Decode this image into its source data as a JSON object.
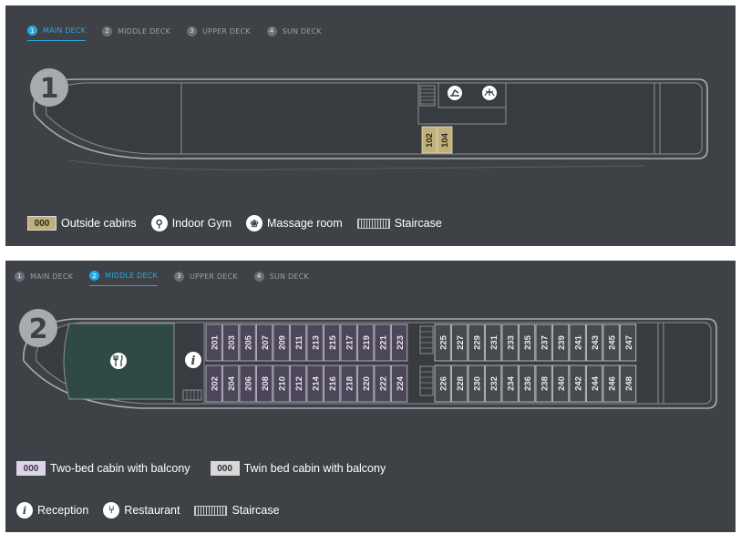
{
  "tabs": [
    {
      "num": "1",
      "label": "MAIN DECK"
    },
    {
      "num": "2",
      "label": "MIDDLE DECK"
    },
    {
      "num": "3",
      "label": "UPPER DECK"
    },
    {
      "num": "4",
      "label": "SUN DECK"
    }
  ],
  "deck1": {
    "badge": "1",
    "active_tab": 0,
    "cabins": [
      "102",
      "104"
    ],
    "legend": {
      "outside_swatch": "000",
      "outside_label": "Outside cabins",
      "gym_label": "Indoor Gym",
      "massage_label": "Massage room",
      "staircase_label": "Staircase"
    }
  },
  "deck2": {
    "badge": "2",
    "active_tab": 1,
    "top_row_left": [
      "201",
      "203",
      "205",
      "207",
      "209",
      "211",
      "213",
      "215",
      "217",
      "219",
      "221",
      "223"
    ],
    "top_row_right": [
      "225",
      "227",
      "229",
      "231",
      "233",
      "235",
      "237",
      "239",
      "241",
      "243",
      "245",
      "247"
    ],
    "bottom_row_left": [
      "202",
      "204",
      "206",
      "208",
      "210",
      "212",
      "214",
      "216",
      "218",
      "220",
      "222",
      "224"
    ],
    "bottom_row_right": [
      "226",
      "228",
      "230",
      "232",
      "234",
      "236",
      "238",
      "240",
      "242",
      "244",
      "246",
      "248"
    ],
    "legend": {
      "two_bed_swatch": "000",
      "two_bed_label": "Two-bed cabin with balcony",
      "twin_bed_swatch": "000",
      "twin_bed_label": "Twin bed cabin with balcony",
      "reception_label": "Reception",
      "restaurant_label": "Restaurant",
      "staircase_label": "Staircase"
    }
  },
  "colors": {
    "panel_bg": "#3e4146",
    "accent": "#2ba6e0",
    "outside_cabin": "#c2b07a",
    "two_bed_cabin": "#ded5e6",
    "twin_bed_cabin": "#d8d8d8",
    "restaurant": "#2f4a45"
  }
}
